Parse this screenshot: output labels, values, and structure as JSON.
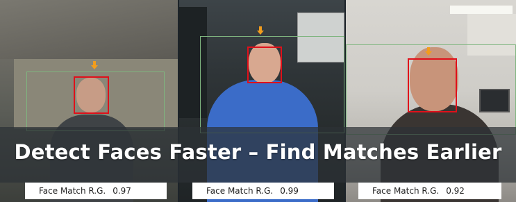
{
  "headline": "Detect Faces Faster – Find Matches Earlier",
  "colors": {
    "face_box": "#e0101a",
    "zone_box": "#7fb57f",
    "arrow": "#f29d1d",
    "headline_bar": "#2d3236"
  },
  "panels": [
    {
      "match_label": "Face Match R.G.",
      "score": "0.97",
      "icon": "down-arrow-icon"
    },
    {
      "match_label": "Face Match R.G.",
      "score": "0.99",
      "icon": "down-arrow-icon"
    },
    {
      "match_label": "Face Match R.G.",
      "score": "0.92",
      "icon": "down-arrow-icon"
    }
  ]
}
